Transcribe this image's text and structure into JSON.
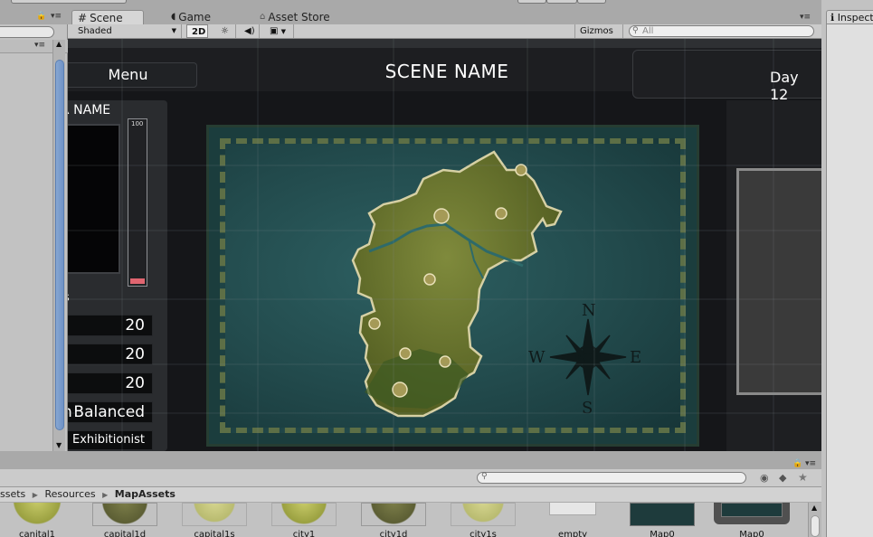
{
  "tabs": {
    "scene": "Scene",
    "game": "Game",
    "asset_store": "Asset Store",
    "inspector": "Inspector"
  },
  "toolbar": {
    "shading_mode": "Shaded",
    "mode_2d": "2D",
    "gizmos": "Gizmos",
    "search_placeholder": "All"
  },
  "scene": {
    "menu_button": "Menu",
    "title": "SCENE NAME",
    "day": "Day 12",
    "player_name": "R NAME",
    "bar_max": "100",
    "bar_level": 0.04,
    "stats_heading": "s",
    "stats": [
      "20",
      "20",
      "20",
      "Balanced",
      "Exhibitionist"
    ],
    "stat_prefixes": [
      "",
      "",
      "",
      "n",
      ""
    ]
  },
  "project": {
    "breadcrumb": [
      "ssets",
      "Resources",
      "MapAssets"
    ],
    "assets": [
      "canital1",
      "capital1d",
      "capital1s",
      "city1",
      "city1d",
      "city1s",
      "empty",
      "Map0",
      "Map0"
    ]
  },
  "colors": {
    "editor_bg": "#c2c2c2",
    "scene_bg": "#151619",
    "map_water": "#224a4c",
    "land": "#6b7a2e",
    "health_bar": "#e06570",
    "scrollbar_thumb": "#6f92c6"
  },
  "icons": [
    "lock-icon",
    "menu-icon",
    "scene-hash-icon",
    "game-pacman-icon",
    "store-bag-icon",
    "sun-icon",
    "audio-icon",
    "image-icon",
    "search-icon",
    "info-icon",
    "label-icon",
    "star-icon"
  ]
}
